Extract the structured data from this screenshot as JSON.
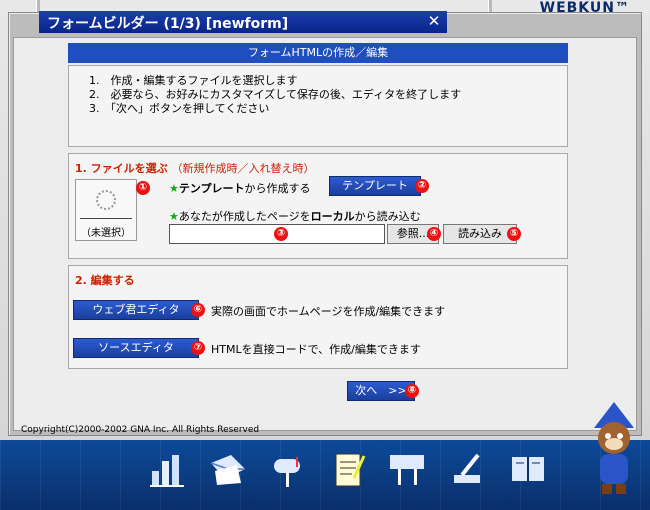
{
  "brand": "WEBKUN™",
  "window": {
    "title": "フォームビルダー (1/3) [newform]",
    "close": "✕",
    "header": "フォームHTMLの作成／編集"
  },
  "instructions": [
    "1.　作成・編集するファイルを選択します",
    "2.　必要なら、お好みにカスタマイズして保存の後、エディタを終了します",
    "3.　「次へ」ボタンを押してください"
  ],
  "section_file": {
    "title": "1. ファイルを選ぶ",
    "subtitle": "（新規作成時／入れ替え時）",
    "unselected": "（未選択）",
    "template_label_pre": "テンプレート",
    "template_label_post": "から作成する",
    "template_button": "テンプレート",
    "local_label_a": "あなたが作成したページを",
    "local_label_b": "ローカル",
    "local_label_c": "から読み込む",
    "browse_button": "参照...",
    "load_button": "読み込み",
    "star": "★",
    "file_path_value": ""
  },
  "section_edit": {
    "title": "2. 編集する",
    "web_editor_button": "ウェブ君エディタ",
    "web_editor_desc": "実際の画面でホームページを作成/編集できます",
    "source_editor_button": "ソースエディタ",
    "source_editor_desc": "HTMLを直接コードで、作成/編集できます"
  },
  "next_button": "次へ　>>",
  "badges": [
    "①",
    "②",
    "③",
    "④",
    "⑤",
    "⑥",
    "⑦",
    "⑧"
  ],
  "copyright": "Copyright(C)2000-2002 GNA Inc. All Rights Reserved",
  "dock_icons": [
    "chart-icon",
    "mail-icon",
    "mailbox-icon",
    "form-icon",
    "signboard-icon",
    "pen-icon",
    "book-icon"
  ]
}
